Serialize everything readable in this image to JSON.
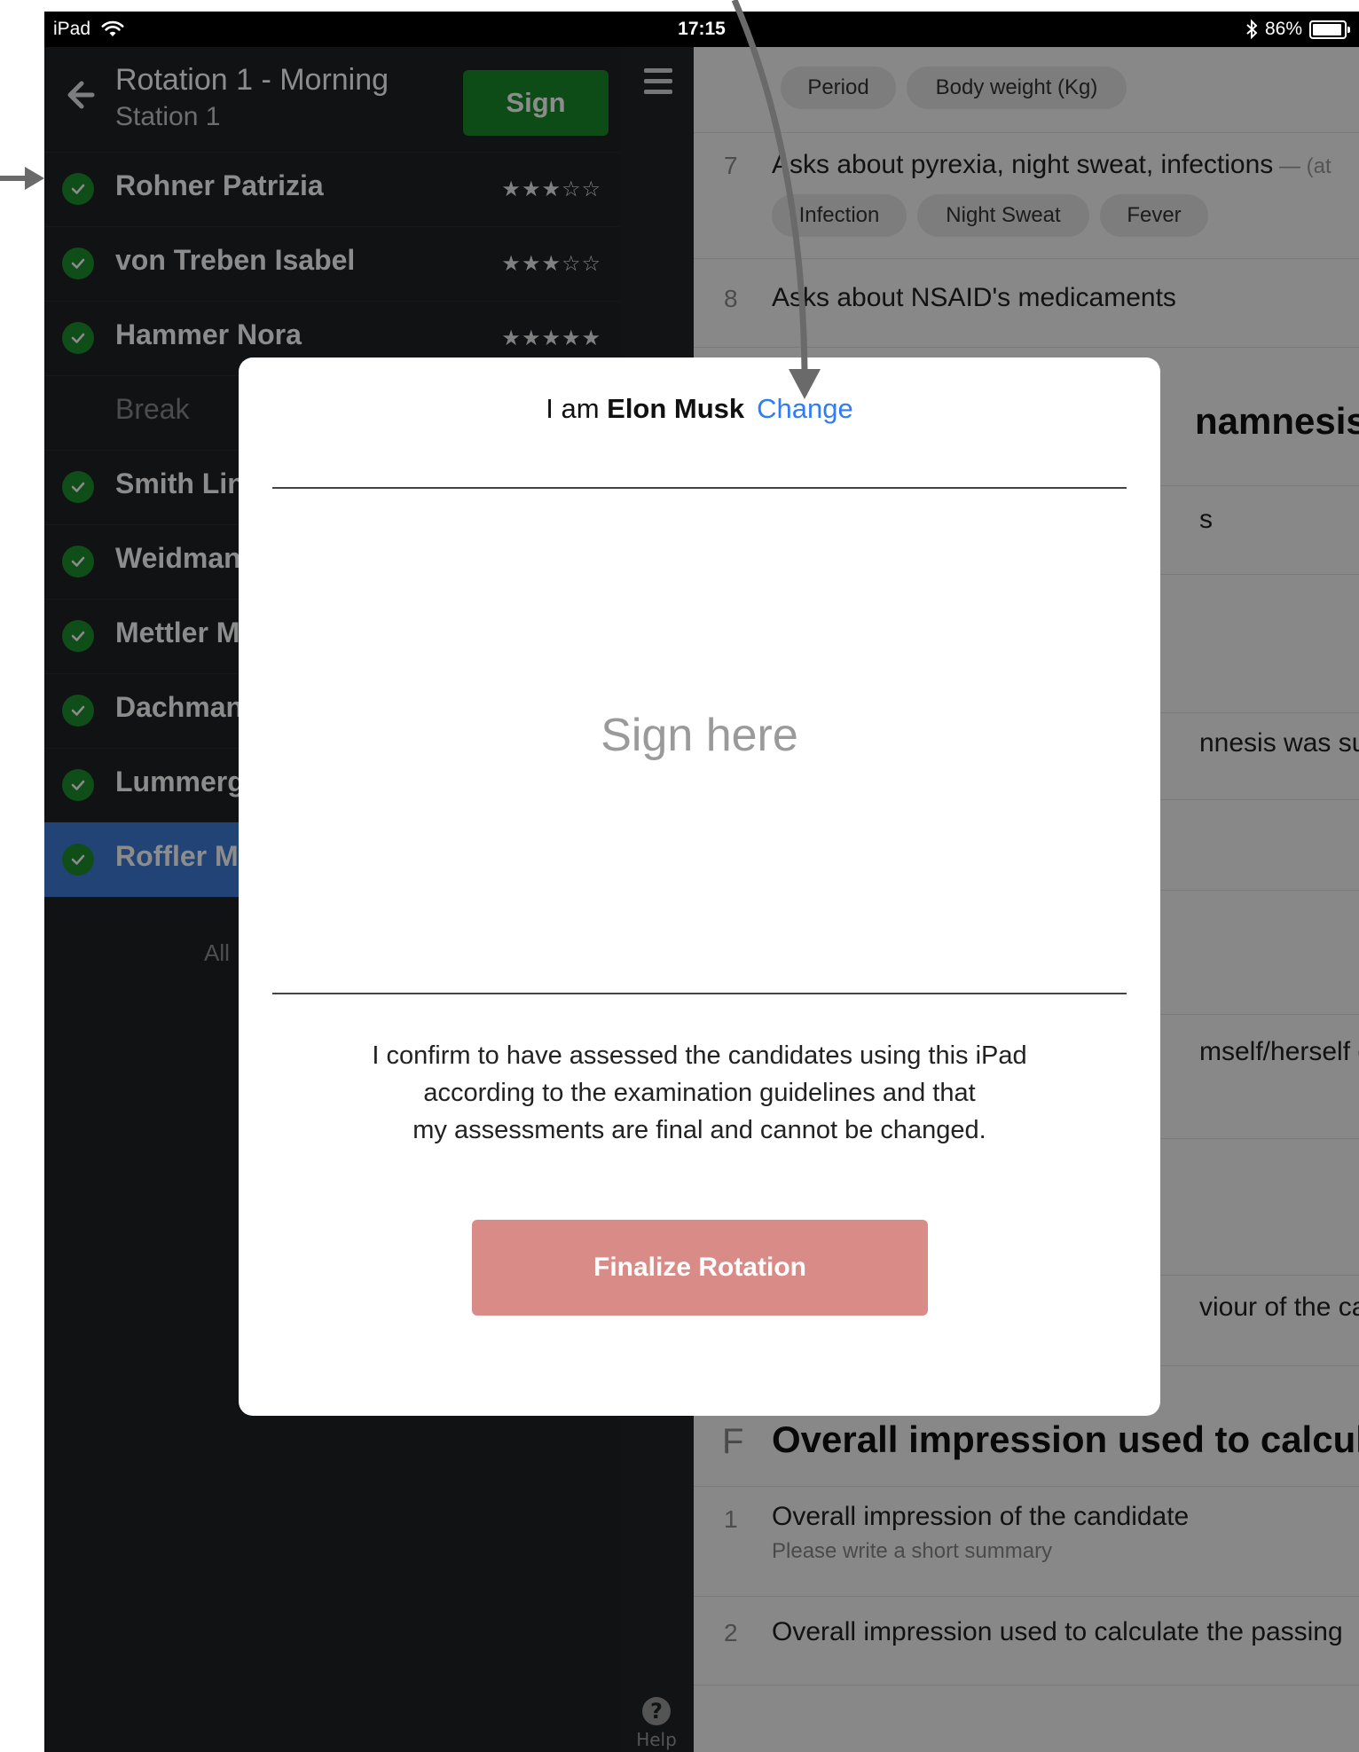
{
  "status_bar": {
    "device": "iPad",
    "time": "17:15",
    "battery": "86%"
  },
  "sidebar": {
    "title": "Rotation 1 - Morning",
    "subtitle": "Station 1",
    "sign_button": "Sign",
    "candidates": [
      {
        "name": "Rohner Patrizia",
        "stars": "★★★☆☆",
        "rating": 3
      },
      {
        "name": "von Treben Isabel",
        "stars": "★★★☆☆",
        "rating": 3
      },
      {
        "name": "Hammer Nora",
        "stars": "★★★★★",
        "rating": 5
      },
      {
        "name": "Break"
      },
      {
        "name": "Smith Lin"
      },
      {
        "name": "Weidman"
      },
      {
        "name": "Mettler M"
      },
      {
        "name": "Dachman"
      },
      {
        "name": "Lummerg"
      },
      {
        "name": "Roffler M"
      }
    ],
    "all_label": "All"
  },
  "menu": {
    "help_label": "Help"
  },
  "main": {
    "chips_top": [
      "Period",
      "Body weight (Kg)"
    ],
    "q7_num": "7",
    "q7_text": "Asks about pyrexia, night sweat, infections",
    "q7_suffix": " — (at",
    "q7_chips": [
      "Infection",
      "Night Sweat",
      "Fever"
    ],
    "q8_num": "8",
    "q8_text": "Asks about NSAID's medicaments",
    "sec_partial": "namnesis",
    "row_partial_1": "s",
    "row_partial_2": "nnesis was suffic",
    "row_partial_3": "mself/herself cle",
    "row_partial_4": "viour of the canc",
    "sec_f_letter": "F",
    "sec_f_title": "Overall impression used to calculat",
    "f1_num": "1",
    "f1_text": "Overall impression of the candidate",
    "f1_sub": "Please write a short summary",
    "f2_num": "2",
    "f2_text": "Overall impression used to calculate the passing"
  },
  "modal": {
    "iam_prefix": "I am ",
    "iam_name": "Elon Musk",
    "change_link": "Change",
    "sign_placeholder": "Sign here",
    "confirm_line1": "I confirm to have assessed the candidates using this iPad",
    "confirm_line2": "according to the examination guidelines and that",
    "confirm_line3": "my assessments are final and cannot be changed.",
    "finalize_button": "Finalize Rotation"
  },
  "colors": {
    "sidebar_bg": "#1f2123",
    "sign_green": "#1b8a2b",
    "selected_blue": "#3f7ad6",
    "check_green": "#1d8f2e",
    "link_blue": "#2f7cf6",
    "finalize_red": "#d98c87"
  }
}
